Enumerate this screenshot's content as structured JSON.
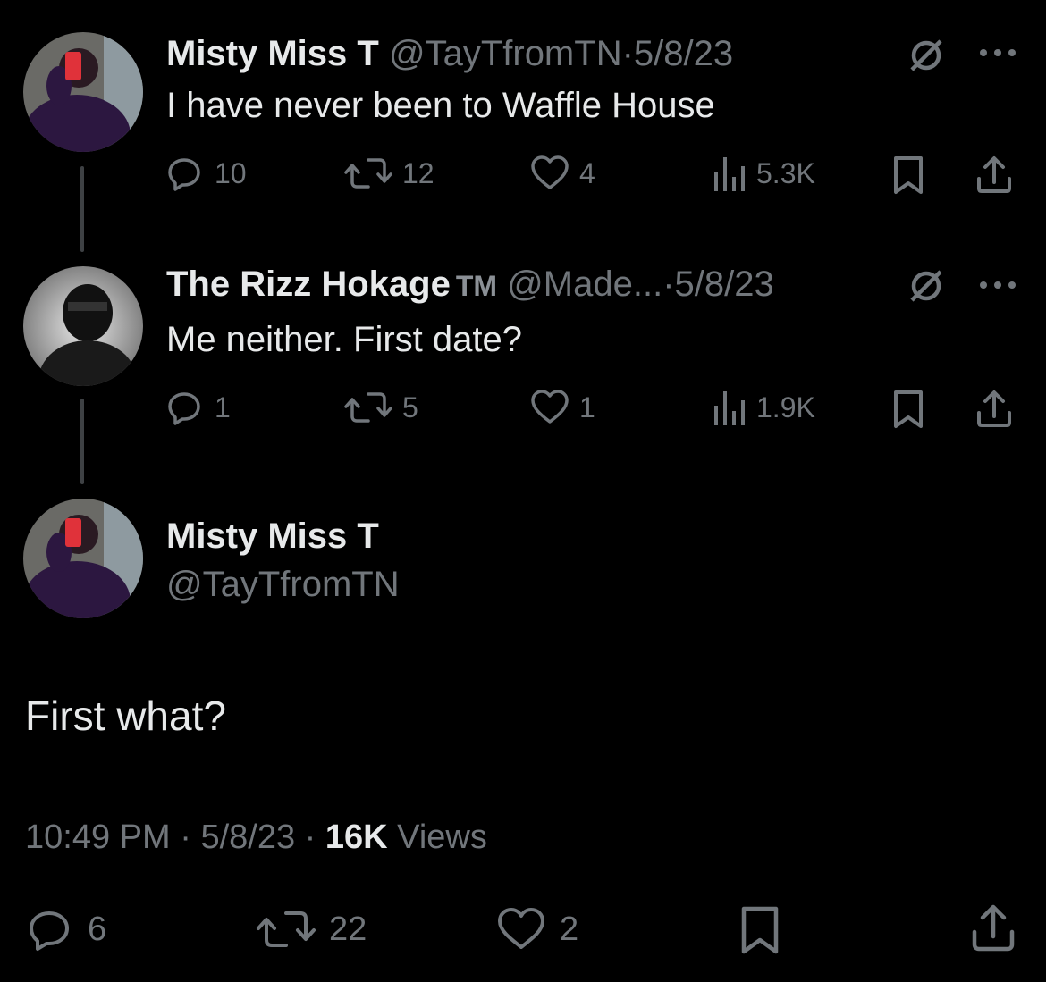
{
  "tweet1": {
    "name": "Misty Miss T",
    "handle": "@TayTfromTN",
    "date": "5/8/23",
    "text": "I have never been to Waffle House",
    "replies": "10",
    "retweets": "12",
    "likes": "4",
    "views": "5.3K"
  },
  "tweet2": {
    "name": "The Rizz Hokage",
    "tm": "TM",
    "handle": "@Made...",
    "date": "5/8/23",
    "text": "Me neither. First date?",
    "replies": "1",
    "retweets": "5",
    "likes": "1",
    "views": "1.9K"
  },
  "main": {
    "name": "Misty Miss T",
    "handle": "@TayTfromTN",
    "text": "First what?",
    "time": "10:49 PM",
    "date": "5/8/23",
    "views_count": "16K",
    "views_label": "Views",
    "replies": "6",
    "retweets": "22",
    "likes": "2"
  },
  "separator": "·",
  "colors": {
    "background": "#000000",
    "text": "#e7e9ea",
    "muted": "#71767b",
    "thread_line": "#3e4144"
  }
}
